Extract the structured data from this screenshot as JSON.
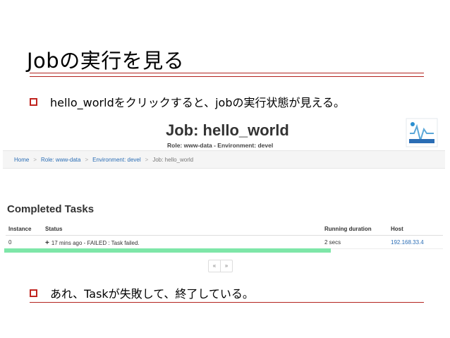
{
  "slide": {
    "title": "Jobの実行を見る",
    "bullet1": "hello_worldをクリックすると、jobの実行状態が見える。",
    "bullet2": "あれ、Taskが失敗して、終了している。"
  },
  "job_page": {
    "title": "Job: hello_world",
    "subtitle": "Role: www-data - Environment: devel",
    "breadcrumb": [
      "Home",
      "Role: www-data",
      "Environment: devel",
      "Job: hello_world"
    ],
    "breadcrumb_separator": ">",
    "section_title": "Completed Tasks",
    "table": {
      "headers": [
        "Instance",
        "Status",
        "Running duration",
        "Host"
      ],
      "rows": [
        {
          "instance": "0",
          "status_icon": "+",
          "status": "17 mins ago - FAILED : Task failed.",
          "duration": "2 secs",
          "host": "192.168.33.4"
        }
      ]
    },
    "pager": {
      "prev": "«",
      "next": "»"
    },
    "progress_fraction": 0.73
  },
  "colors": {
    "accent_red": "#c0241f",
    "link_blue": "#2a6db5",
    "progress_green": "#7ee6a8"
  },
  "icons": {
    "logo": "aurora-logo-icon",
    "bullet": "square-bullet-icon"
  }
}
